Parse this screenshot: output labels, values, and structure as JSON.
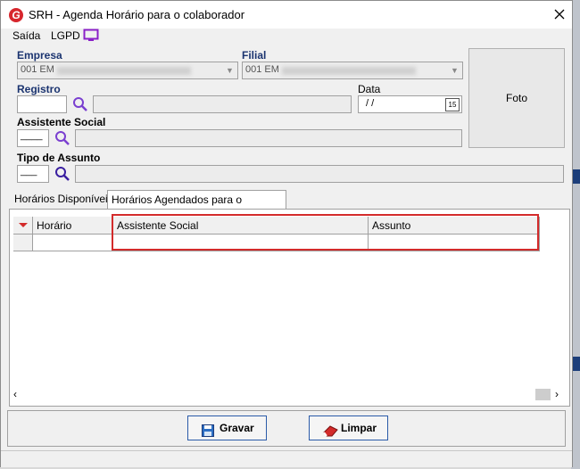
{
  "window": {
    "title": "SRH - Agenda Horário para o colaborador",
    "logo_letter": "G"
  },
  "menu": [
    {
      "label": "Saída"
    },
    {
      "label": "LGPD"
    }
  ],
  "form": {
    "empresa_label": "Empresa",
    "empresa_value": "001 EM",
    "filial_label": "Filial",
    "filial_value": "001 EM",
    "registro_label": "Registro",
    "data_label": "Data",
    "data_value": " /  / ",
    "calendar_day": "15",
    "assistente_label": "Assistente Social",
    "assistente_value": "____",
    "tipo_label": "Tipo de Assunto",
    "tipo_value": "___"
  },
  "foto_label": "Foto",
  "tabs": [
    {
      "label": "Horários Disponíveis"
    },
    {
      "label": "Horários Agendados para o colaborador"
    }
  ],
  "grid": {
    "columns": [
      "Horário",
      "Assistente Social",
      "Assunto"
    ]
  },
  "buttons": {
    "gravar": "Gravar",
    "limpar": "Limpar"
  },
  "colors": {
    "label_blue": "#1b3470",
    "highlight_red": "#d32b2b",
    "logo_red": "#d7262d",
    "search_purple": "#7a3fd0",
    "lgpd_purple": "#8a20c8"
  }
}
